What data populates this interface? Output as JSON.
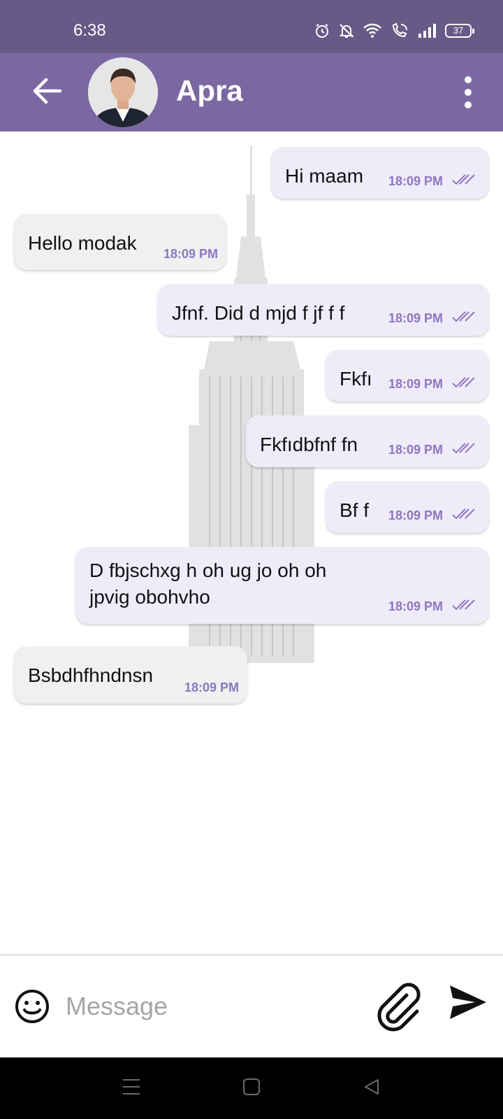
{
  "status_bar": {
    "time": "6:38",
    "battery": "37",
    "icons": [
      "alarm-icon",
      "mute-bell-icon",
      "wifi-icon",
      "wifi-calling-icon",
      "signal-icon",
      "battery-icon"
    ]
  },
  "app_bar": {
    "contact_name": "Apra",
    "back_icon": "back-arrow-icon",
    "menu_icon": "more-vert-icon"
  },
  "messages": [
    {
      "direction": "out",
      "text": "Hi maam",
      "time": "18:09 PM",
      "status": "read"
    },
    {
      "direction": "in",
      "text": "Hello modak",
      "time": "18:09 PM"
    },
    {
      "direction": "out",
      "text": "Jfnf. Did d mjd f jf f f",
      "time": "18:09 PM",
      "status": "read"
    },
    {
      "direction": "out",
      "text": "Fkfı",
      "time": "18:09 PM",
      "status": "read"
    },
    {
      "direction": "out",
      "text": "Fkfıdbfnf fn",
      "time": "18:09 PM",
      "status": "read"
    },
    {
      "direction": "out",
      "text": "Bf f",
      "time": "18:09 PM",
      "status": "read"
    },
    {
      "direction": "out",
      "text_line1": "D fbjschxg h oh ug jo oh oh",
      "text_line2": "jpvig obohvho",
      "time": "18:09 PM",
      "status": "read"
    },
    {
      "direction": "in",
      "text": "Bsbdhfhndnsn",
      "time": "18:09 PM"
    }
  ],
  "input_bar": {
    "placeholder": "Message",
    "value": "",
    "icons": [
      "emoji-icon",
      "attach-icon",
      "send-icon"
    ]
  },
  "nav_bar": {
    "icons": [
      "menu-icon",
      "home-icon",
      "back-icon"
    ]
  },
  "colors": {
    "status_bar": "#665a86",
    "app_bar": "#7b68a2",
    "outgoing_bubble": "#efebf9",
    "incoming_bubble": "#f0f0f0",
    "timestamp": "#8a78c0"
  }
}
